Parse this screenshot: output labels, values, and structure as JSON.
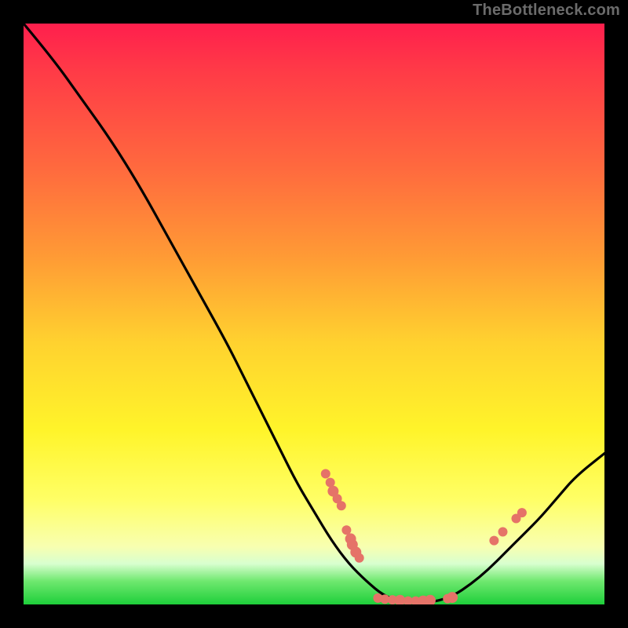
{
  "attribution": "TheBottleneck.com",
  "colors": {
    "point": "#e57368",
    "curve": "#000000",
    "frame": "#000000"
  },
  "chart_data": {
    "type": "line",
    "title": "",
    "xlabel": "",
    "ylabel": "",
    "xlim": [
      0,
      1
    ],
    "ylim": [
      0,
      1
    ],
    "note": "Axes are unlabeled. y is shown as relative bottleneck severity: 0 ≈ optimum (green bottom), 1 ≈ worst (red top). x is relative position of the varied component. Values are visually estimated from the image.",
    "curve": [
      {
        "x": 0.0,
        "y": 1.0
      },
      {
        "x": 0.05,
        "y": 0.94
      },
      {
        "x": 0.1,
        "y": 0.87
      },
      {
        "x": 0.15,
        "y": 0.8
      },
      {
        "x": 0.2,
        "y": 0.72
      },
      {
        "x": 0.25,
        "y": 0.63
      },
      {
        "x": 0.3,
        "y": 0.54
      },
      {
        "x": 0.35,
        "y": 0.45
      },
      {
        "x": 0.38,
        "y": 0.39
      },
      {
        "x": 0.41,
        "y": 0.33
      },
      {
        "x": 0.44,
        "y": 0.27
      },
      {
        "x": 0.47,
        "y": 0.21
      },
      {
        "x": 0.5,
        "y": 0.16
      },
      {
        "x": 0.53,
        "y": 0.11
      },
      {
        "x": 0.56,
        "y": 0.07
      },
      {
        "x": 0.59,
        "y": 0.04
      },
      {
        "x": 0.62,
        "y": 0.015
      },
      {
        "x": 0.65,
        "y": 0.005
      },
      {
        "x": 0.68,
        "y": 0.003
      },
      {
        "x": 0.71,
        "y": 0.005
      },
      {
        "x": 0.74,
        "y": 0.015
      },
      {
        "x": 0.77,
        "y": 0.035
      },
      {
        "x": 0.8,
        "y": 0.06
      },
      {
        "x": 0.83,
        "y": 0.09
      },
      {
        "x": 0.86,
        "y": 0.12
      },
      {
        "x": 0.89,
        "y": 0.15
      },
      {
        "x": 0.92,
        "y": 0.185
      },
      {
        "x": 0.95,
        "y": 0.22
      },
      {
        "x": 1.0,
        "y": 0.26
      }
    ],
    "points": [
      {
        "x": 0.52,
        "y": 0.225,
        "r": 6
      },
      {
        "x": 0.528,
        "y": 0.21,
        "r": 6
      },
      {
        "x": 0.533,
        "y": 0.195,
        "r": 7
      },
      {
        "x": 0.54,
        "y": 0.182,
        "r": 6
      },
      {
        "x": 0.547,
        "y": 0.17,
        "r": 6
      },
      {
        "x": 0.556,
        "y": 0.128,
        "r": 6
      },
      {
        "x": 0.563,
        "y": 0.113,
        "r": 7
      },
      {
        "x": 0.566,
        "y": 0.103,
        "r": 7
      },
      {
        "x": 0.572,
        "y": 0.09,
        "r": 7
      },
      {
        "x": 0.578,
        "y": 0.08,
        "r": 6
      },
      {
        "x": 0.61,
        "y": 0.011,
        "r": 6
      },
      {
        "x": 0.622,
        "y": 0.009,
        "r": 6
      },
      {
        "x": 0.635,
        "y": 0.008,
        "r": 6
      },
      {
        "x": 0.648,
        "y": 0.007,
        "r": 7
      },
      {
        "x": 0.662,
        "y": 0.006,
        "r": 6
      },
      {
        "x": 0.675,
        "y": 0.006,
        "r": 6
      },
      {
        "x": 0.688,
        "y": 0.006,
        "r": 7
      },
      {
        "x": 0.7,
        "y": 0.007,
        "r": 7
      },
      {
        "x": 0.73,
        "y": 0.01,
        "r": 6
      },
      {
        "x": 0.738,
        "y": 0.012,
        "r": 7
      },
      {
        "x": 0.81,
        "y": 0.11,
        "r": 6
      },
      {
        "x": 0.825,
        "y": 0.125,
        "r": 6
      },
      {
        "x": 0.848,
        "y": 0.148,
        "r": 6
      },
      {
        "x": 0.858,
        "y": 0.158,
        "r": 6
      }
    ]
  }
}
